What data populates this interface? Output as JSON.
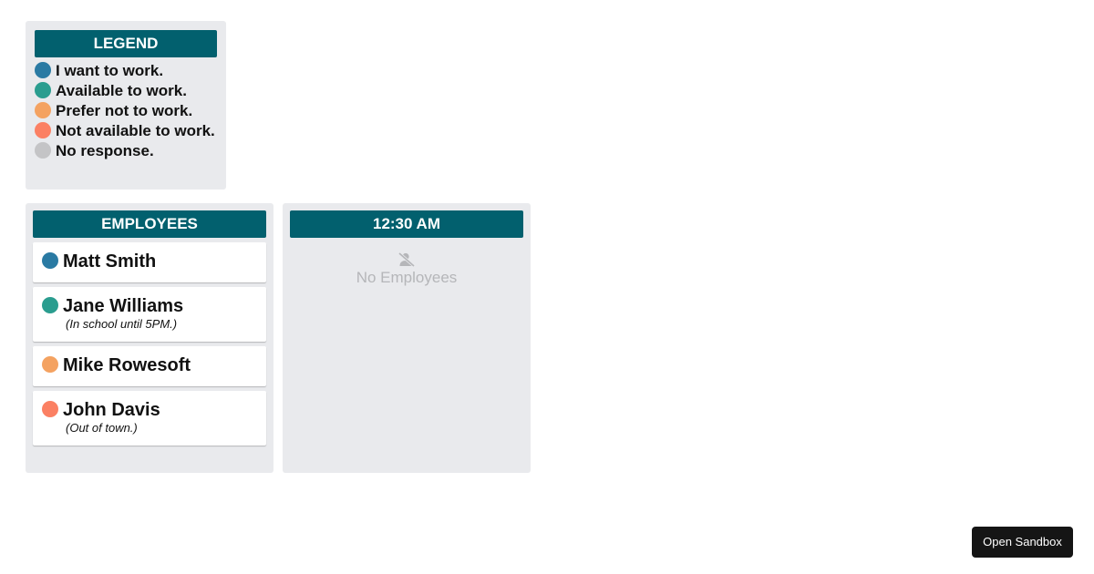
{
  "legend": {
    "title": "LEGEND",
    "items": [
      {
        "label": "I want to work.",
        "color": "#2a7aa3"
      },
      {
        "label": "Available to work.",
        "color": "#2a9d8f"
      },
      {
        "label": "Prefer not to work.",
        "color": "#f4a261"
      },
      {
        "label": "Not available to work.",
        "color": "#fb8063"
      },
      {
        "label": "No response.",
        "color": "#c4c4c6"
      }
    ]
  },
  "employees": {
    "title": "EMPLOYEES",
    "items": [
      {
        "name": "Matt Smith",
        "note": "",
        "color": "#2a7aa3"
      },
      {
        "name": "Jane Williams",
        "note": "(In school until 5PM.)",
        "color": "#2a9d8f"
      },
      {
        "name": "Mike Rowesoft",
        "note": "",
        "color": "#f4a261"
      },
      {
        "name": "John Davis",
        "note": "(Out of town.)",
        "color": "#fb8063"
      }
    ]
  },
  "time_slot": {
    "title": "12:30 AM",
    "empty_text": "No Employees",
    "empty_icon": "user-slash-icon"
  },
  "sandbox_button": {
    "label": "Open Sandbox"
  },
  "colors": {
    "header": "#02606e",
    "panel": "#e9eaed"
  }
}
